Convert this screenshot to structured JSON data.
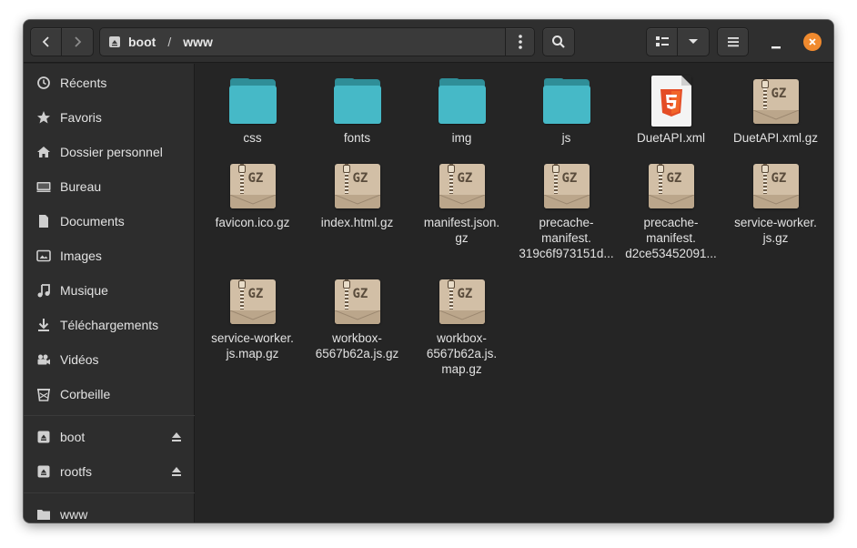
{
  "pathbar": {
    "segments": [
      "boot",
      "www"
    ],
    "separator": "/"
  },
  "sidebar": {
    "places": [
      {
        "label": "Récents",
        "icon": "clock-icon"
      },
      {
        "label": "Favoris",
        "icon": "star-icon"
      },
      {
        "label": "Dossier personnel",
        "icon": "home-icon"
      },
      {
        "label": "Bureau",
        "icon": "desktop-icon"
      },
      {
        "label": "Documents",
        "icon": "document-icon"
      },
      {
        "label": "Images",
        "icon": "image-icon"
      },
      {
        "label": "Musique",
        "icon": "music-icon"
      },
      {
        "label": "Téléchargements",
        "icon": "download-icon"
      },
      {
        "label": "Vidéos",
        "icon": "video-icon"
      },
      {
        "label": "Corbeille",
        "icon": "trash-icon"
      }
    ],
    "devices": [
      {
        "label": "boot",
        "icon": "drive-icon",
        "eject": true
      },
      {
        "label": "rootfs",
        "icon": "drive-icon",
        "eject": true
      }
    ],
    "bookmarks": [
      {
        "label": "www",
        "icon": "folder-icon"
      }
    ]
  },
  "files": [
    {
      "name": "css",
      "type": "folder"
    },
    {
      "name": "fonts",
      "type": "folder"
    },
    {
      "name": "img",
      "type": "folder"
    },
    {
      "name": "js",
      "type": "folder"
    },
    {
      "name": "DuetAPI.xml",
      "type": "html"
    },
    {
      "name": "DuetAPI.xml.gz",
      "type": "archive"
    },
    {
      "name": "favicon.ico.gz",
      "type": "archive"
    },
    {
      "name": "index.html.gz",
      "type": "archive"
    },
    {
      "name": "manifest.json.\ngz",
      "type": "archive"
    },
    {
      "name": "precache-\nmanifest.\n319c6f973151d...",
      "type": "archive"
    },
    {
      "name": "precache-\nmanifest.\nd2ce53452091...",
      "type": "archive"
    },
    {
      "name": "service-worker.\njs.gz",
      "type": "archive"
    },
    {
      "name": "service-worker.\njs.map.gz",
      "type": "archive"
    },
    {
      "name": "workbox-\n6567b62a.js.gz",
      "type": "archive"
    },
    {
      "name": "workbox-\n6567b62a.js.\nmap.gz",
      "type": "archive"
    }
  ],
  "archive_badge": "GZ",
  "colors": {
    "window_bg": "#252525",
    "sidebar_bg": "#2d2d2d",
    "folder": "#46b9c7",
    "close_button": "#f08a2e",
    "html5": "#e44d26"
  }
}
